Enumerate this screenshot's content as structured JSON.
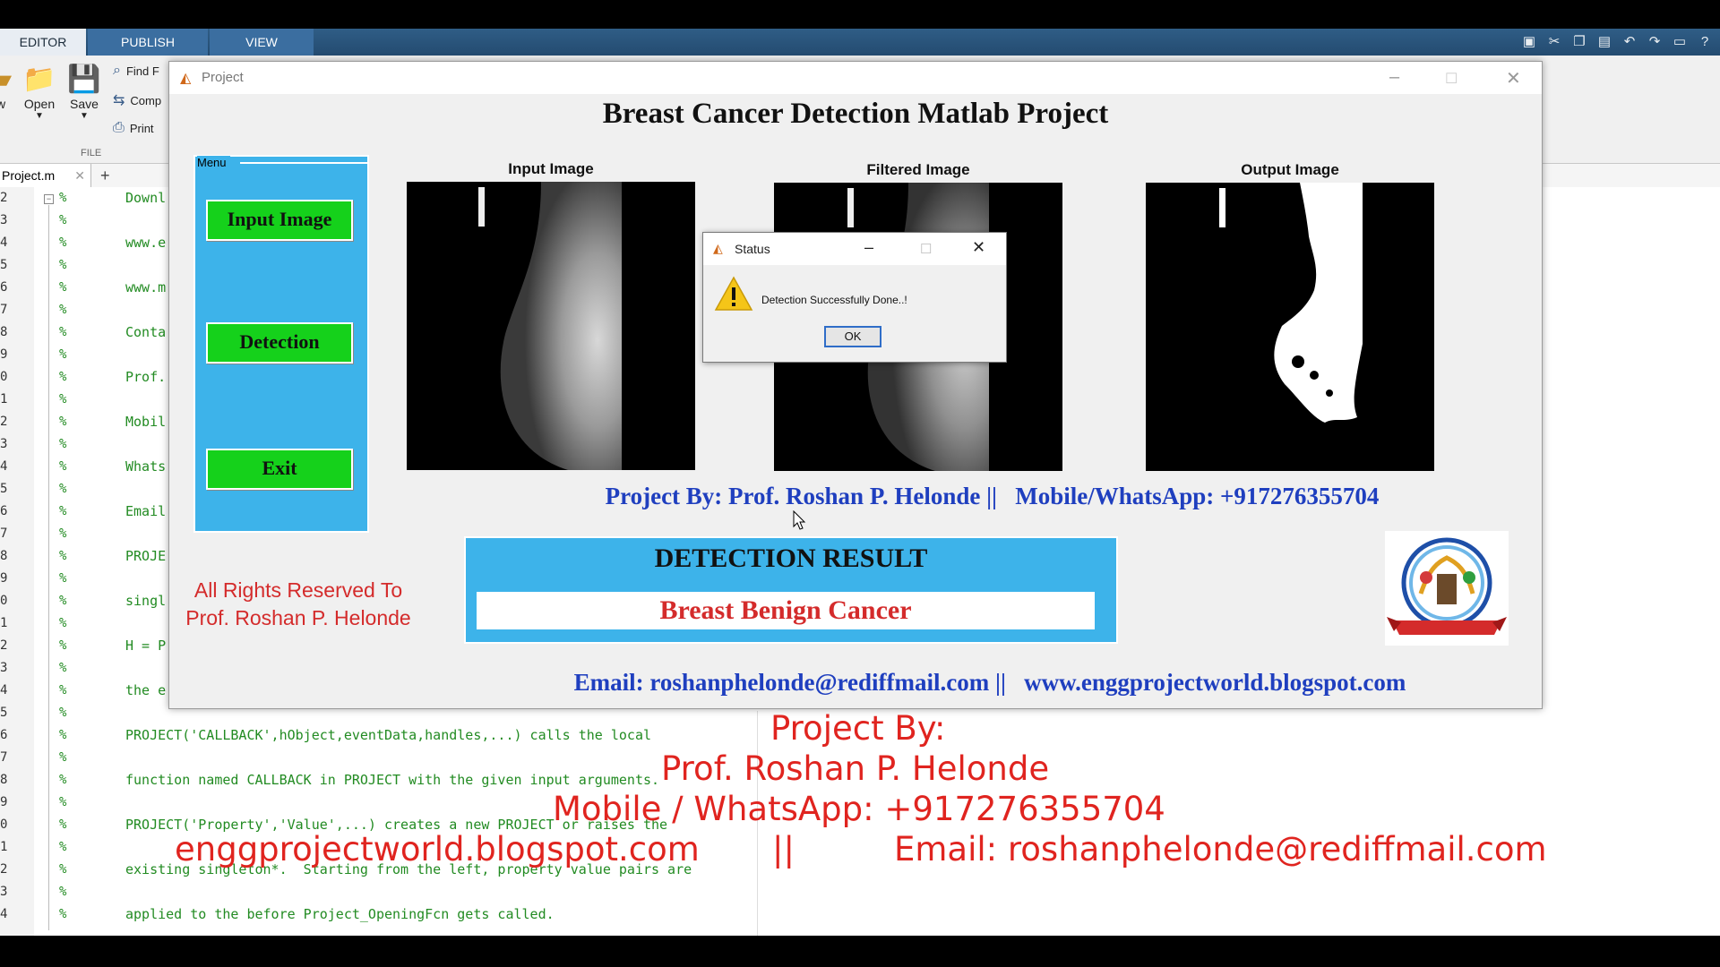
{
  "ribbon": {
    "tabs": [
      "EDITOR",
      "PUBLISH",
      "VIEW"
    ],
    "buttons": {
      "open": "Open",
      "save": "Save",
      "w": "w"
    },
    "small": {
      "find": "Find F",
      "compare": "Comp",
      "print": "Print"
    },
    "file_section": "FILE"
  },
  "editor": {
    "tab_name": "Project.m",
    "line_numbers": [
      "2",
      "3",
      "4",
      "5",
      "6",
      "7",
      "8",
      "9",
      "0",
      "1",
      "2",
      "3",
      "4",
      "5",
      "6",
      "7",
      "8",
      "9",
      "0",
      "1",
      "2",
      "3",
      "4",
      "5",
      "6",
      "7",
      "8",
      "9",
      "0",
      "1",
      "2",
      "3",
      "4"
    ],
    "lines": [
      "Downl",
      "",
      "www.e",
      "",
      "www.m",
      "",
      "Conta",
      "",
      "Prof.",
      "",
      "Mobil",
      "",
      "Whats",
      "",
      "Email",
      "",
      "PROJE",
      "",
      "singl",
      "",
      "H = P",
      "",
      "the e",
      "",
      "PROJECT('CALLBACK',hObject,eventData,handles,...) calls the local",
      "",
      "function named CALLBACK in PROJECT with the given input arguments.",
      "",
      "PROJECT('Property','Value',...) creates a new PROJECT or raises the",
      "",
      "existing singleton*.  Starting from the left, property value pairs are",
      "",
      "applied to the before Project_OpeningFcn gets called."
    ]
  },
  "project_window": {
    "title": "Project",
    "heading": "Breast Cancer Detection Matlab Project",
    "menu": {
      "label": "Menu",
      "buttons": [
        "Input Image",
        "Detection",
        "Exit"
      ]
    },
    "images": {
      "input": "Input Image",
      "filtered": "Filtered Image",
      "output": "Output Image"
    },
    "project_by": "Project By: Prof. Roshan P. Helonde ||   Mobile/WhatsApp: +917276355704",
    "rights": "All Rights Reserved To Prof. Roshan P. Helonde",
    "result": {
      "title": "DETECTION RESULT",
      "value": "Breast Benign Cancer"
    },
    "email_line": "Email: roshanphelonde@rediffmail.com ||   www.enggprojectworld.blogspot.com"
  },
  "status_dialog": {
    "title": "Status",
    "message": "Detection Successfully Done..!",
    "ok": "OK"
  },
  "watermark": {
    "line1": "Project By:",
    "line2": "Prof. Roshan P. Helonde",
    "line3": "Mobile / WhatsApp: +917276355704",
    "line4_left": "enggprojectworld.blogspot.com",
    "line4_sep": "||",
    "line4_right": "Email: roshanphelonde@rediffmail.com"
  },
  "colors": {
    "panel_blue": "#3db3ea",
    "button_green": "#15d11b",
    "link_blue": "#1f3fbf",
    "alert_red": "#d42b2b",
    "code_green": "#228b22"
  }
}
